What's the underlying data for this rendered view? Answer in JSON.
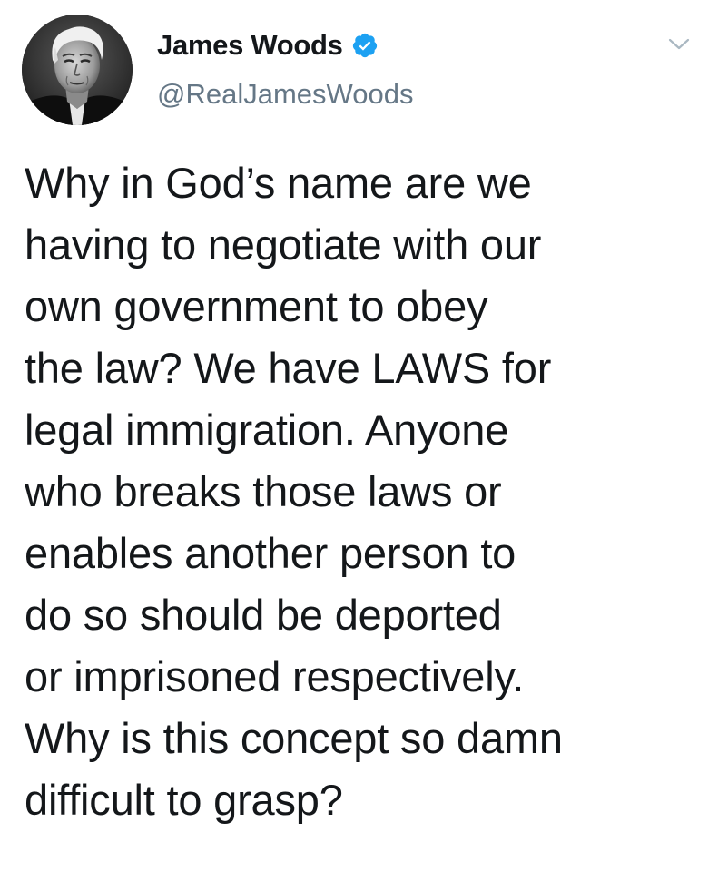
{
  "author": {
    "display_name": "James Woods",
    "handle": "@RealJamesWoods",
    "verified": true,
    "avatar_icon": "profile-photo-icon",
    "verified_icon": "verified-badge-icon"
  },
  "menu": {
    "icon": "chevron-down-icon"
  },
  "tweet": {
    "lines": [
      "Why in God’s name are we",
      "having to negotiate with our",
      "own government to obey",
      "the law? We have LAWS for",
      "legal immigration. Anyone",
      "who breaks those laws or",
      "enables another person to",
      "do so should be deported",
      "or imprisoned respectively.",
      "Why is this concept so damn",
      "difficult to grasp?"
    ]
  },
  "colors": {
    "text": "#14171a",
    "secondary": "#657786",
    "verified": "#1da1f2",
    "chevron": "#aab8c2",
    "background": "#ffffff"
  }
}
